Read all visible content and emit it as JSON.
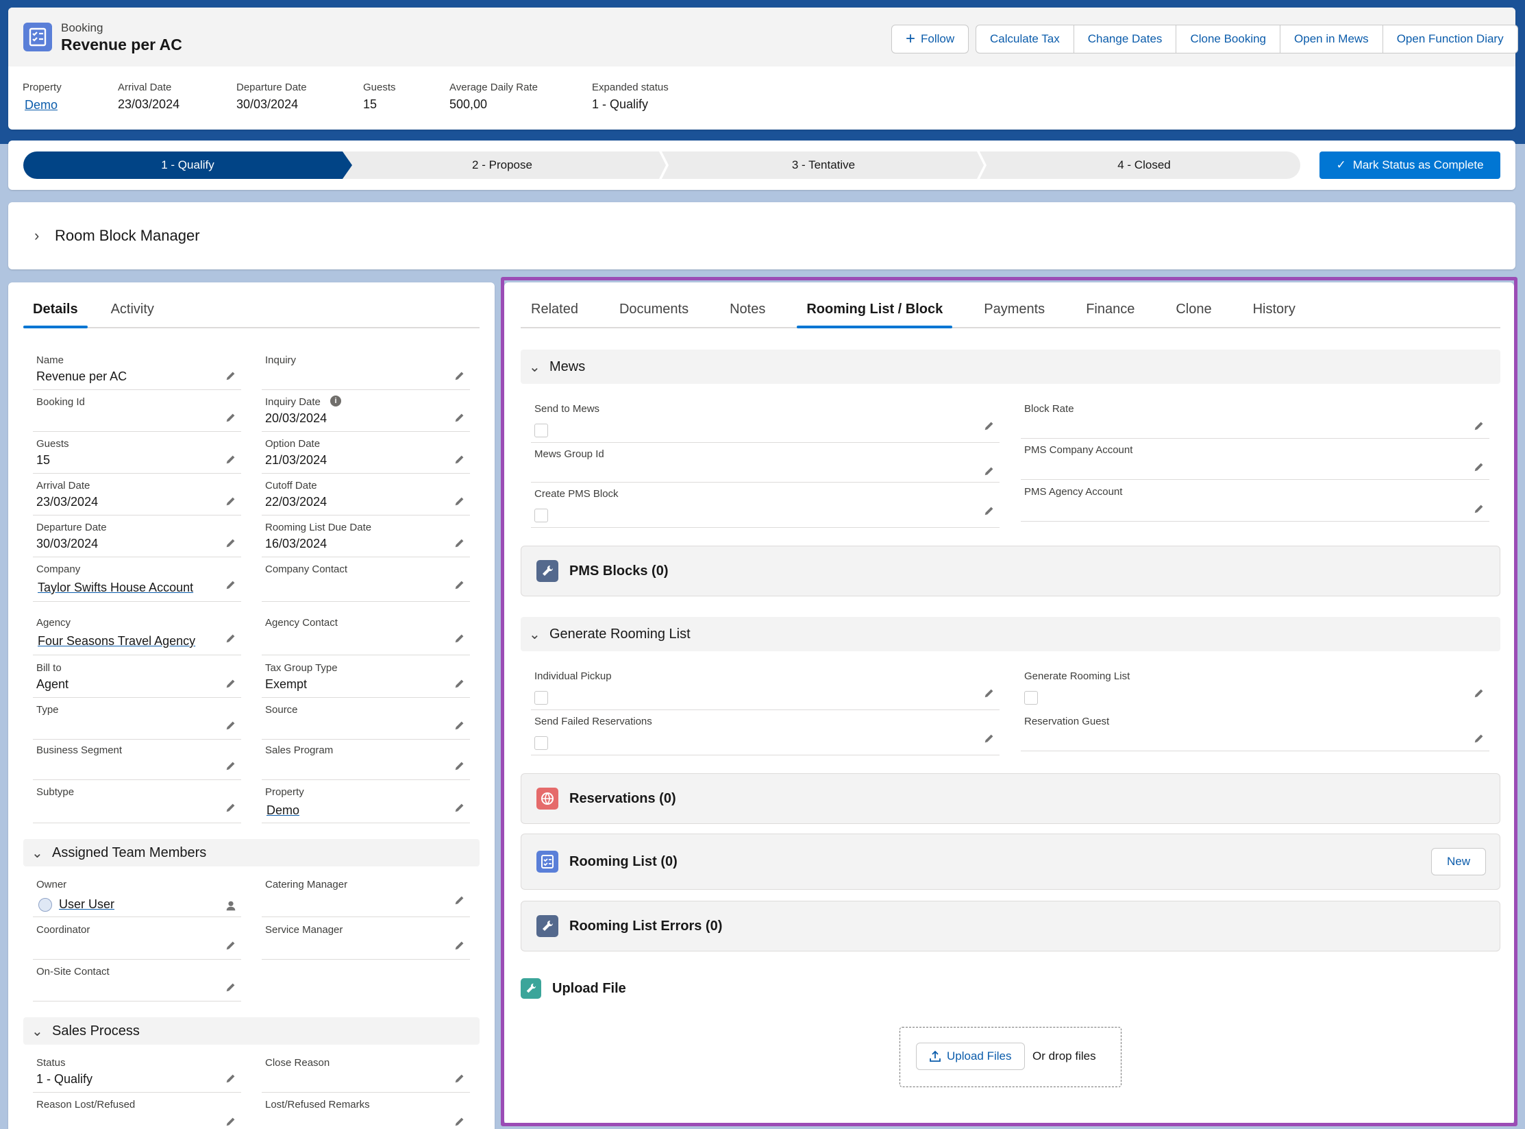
{
  "header": {
    "object_type": "Booking",
    "title": "Revenue per AC",
    "actions": {
      "follow": "Follow",
      "calculate_tax": "Calculate Tax",
      "change_dates": "Change Dates",
      "clone_booking": "Clone Booking",
      "open_in_mews": "Open in Mews",
      "open_function_diary": "Open Function Diary"
    },
    "highlights": {
      "property_label": "Property",
      "property_value": "Demo",
      "arrival_label": "Arrival Date",
      "arrival_value": "23/03/2024",
      "departure_label": "Departure Date",
      "departure_value": "30/03/2024",
      "guests_label": "Guests",
      "guests_value": "15",
      "adr_label": "Average Daily Rate",
      "adr_value": "500,00",
      "status_label": "Expanded status",
      "status_value": "1 - Qualify"
    }
  },
  "path": {
    "steps": [
      "1 - Qualify",
      "2 - Propose",
      "3 - Tentative",
      "4 - Closed"
    ],
    "active_index": 0,
    "complete_button": "Mark Status as Complete"
  },
  "room_block_manager": "Room Block Manager",
  "left": {
    "tabs": [
      "Details",
      "Activity"
    ],
    "fields": {
      "name_l": "Name",
      "name_v": "Revenue per AC",
      "inquiry_l": "Inquiry",
      "inquiry_v": "",
      "booking_id_l": "Booking Id",
      "booking_id_v": "",
      "inquiry_date_l": "Inquiry Date",
      "inquiry_date_v": "20/03/2024",
      "guests_l": "Guests",
      "guests_v": "15",
      "option_date_l": "Option Date",
      "option_date_v": "21/03/2024",
      "arrival_l": "Arrival Date",
      "arrival_v": "23/03/2024",
      "cutoff_l": "Cutoff Date",
      "cutoff_v": "22/03/2024",
      "departure_l": "Departure Date",
      "departure_v": "30/03/2024",
      "rooming_due_l": "Rooming List Due Date",
      "rooming_due_v": "16/03/2024",
      "company_l": "Company",
      "company_v": "Taylor Swifts House Account",
      "company_contact_l": "Company Contact",
      "company_contact_v": "",
      "agency_l": "Agency",
      "agency_v": "Four Seasons Travel Agency",
      "agency_contact_l": "Agency Contact",
      "agency_contact_v": "",
      "bill_to_l": "Bill to",
      "bill_to_v": "Agent",
      "tax_group_l": "Tax Group Type",
      "tax_group_v": "Exempt",
      "type_l": "Type",
      "type_v": "",
      "source_l": "Source",
      "source_v": "",
      "business_segment_l": "Business Segment",
      "business_segment_v": "",
      "sales_program_l": "Sales Program",
      "sales_program_v": "",
      "subtype_l": "Subtype",
      "subtype_v": "",
      "property_l": "Property",
      "property_v": "Demo"
    },
    "team_section": "Assigned Team Members",
    "team": {
      "owner_l": "Owner",
      "owner_v": "User User",
      "catering_l": "Catering Manager",
      "coordinator_l": "Coordinator",
      "service_l": "Service Manager",
      "onsite_l": "On-Site Contact"
    },
    "sales_section": "Sales Process",
    "sales": {
      "status_l": "Status",
      "status_v": "1 - Qualify",
      "close_reason_l": "Close Reason",
      "reason_lost_l": "Reason Lost/Refused",
      "lost_remarks_l": "Lost/Refused Remarks"
    }
  },
  "right": {
    "tabs": [
      "Related",
      "Documents",
      "Notes",
      "Rooming List / Block",
      "Payments",
      "Finance",
      "Clone",
      "History"
    ],
    "active_tab_index": 3,
    "mews_section": "Mews",
    "mews": {
      "send_to_mews": "Send to Mews",
      "block_rate": "Block Rate",
      "mews_group_id": "Mews Group Id",
      "pms_company": "PMS Company Account",
      "create_pms_block": "Create PMS Block",
      "pms_agency": "PMS Agency Account"
    },
    "pms_blocks": "PMS Blocks (0)",
    "generate_section": "Generate Rooming List",
    "generate": {
      "individual_pickup": "Individual Pickup",
      "generate_rooming_list": "Generate Rooming List",
      "send_failed": "Send Failed Reservations",
      "reservation_guest": "Reservation Guest"
    },
    "reservations": "Reservations (0)",
    "rooming_list": "Rooming List (0)",
    "rooming_new": "New",
    "rooming_errors": "Rooming List Errors (0)",
    "upload_title": "Upload File",
    "upload_button": "Upload Files",
    "drop_text": "Or drop files"
  },
  "colors": {
    "brand": "#0176d3",
    "path_active": "#014486",
    "highlight_border": "#9b4cb5"
  }
}
